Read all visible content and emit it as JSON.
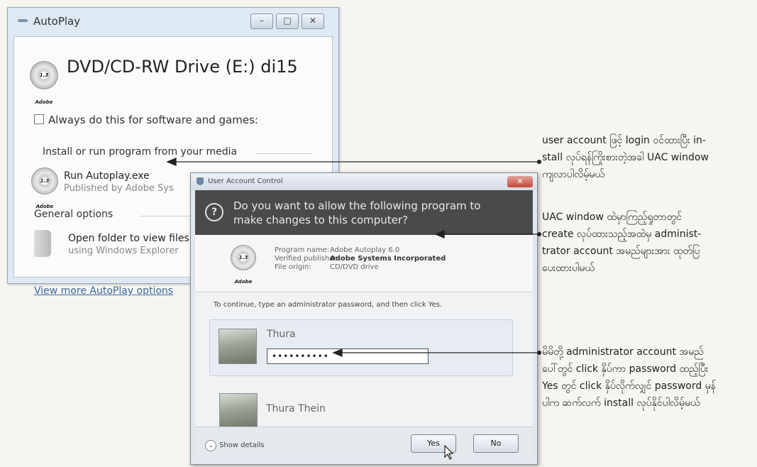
{
  "autoplay": {
    "title": "AutoPlay",
    "window_buttons": [
      "–",
      "□",
      "✕"
    ],
    "disc_logo_text": "1.3 Adobe",
    "drive_title": "DVD/CD-RW Drive (E:) di15",
    "always_checkbox_label": "Always do this for software and games:",
    "section_install": "Install or run program from your media",
    "run_title": "Run Autoplay.exe",
    "run_sub": "Published by Adobe Sys",
    "section_general": "General options",
    "open_title": "Open folder to view files",
    "open_sub": "using Windows Explorer",
    "more_link": "View more AutoPlay options"
  },
  "uac": {
    "title": "User Account Control",
    "close": "✕",
    "question": "Do you want to allow the following program to make changes to this computer?",
    "info_labels": [
      "Program name:",
      "Verified publisher:",
      "File origin:"
    ],
    "info_values": [
      "Adobe Autoplay 6.0",
      "Adobe Systems Incorporated",
      "CD/DVD drive"
    ],
    "instruction": "To continue, type an administrator password, and then click Yes.",
    "accounts": [
      {
        "name": "Thura",
        "password": "••••••••••"
      },
      {
        "name": "Thura Thein"
      }
    ],
    "show_details": "Show details",
    "yes": "Yes",
    "no": "No"
  },
  "annotations": [
    {
      "lines": [
        "user account ဖြင့် login ဝင်ထားပြီး in-",
        "stall လုပ်ရန်ကြိုးစားတဲ့အခါ UAC window",
        "ကျလာပါလိမ့်မယ်"
      ]
    },
    {
      "lines": [
        "UAC window ထဲမှာကြည့်ရှုတာတွင်",
        "create လုပ်ထားသည့်အထဲမှ administ-",
        "trator account အမည်များအား ထုတ်ပြ",
        "ပေးထားပါမယ်"
      ]
    },
    {
      "lines": [
        "မိမိတို့ administrator account အမည်",
        "ပေါ်တွင် click နှိပ်ကာ password ထည့်ပြီး",
        "Yes တွင် click နှိပ်လိုက်လျှင် password မှန်",
        "ပါက ဆက်လက် install လုပ်နိုင်ပါလိမ့်မယ်"
      ]
    }
  ]
}
